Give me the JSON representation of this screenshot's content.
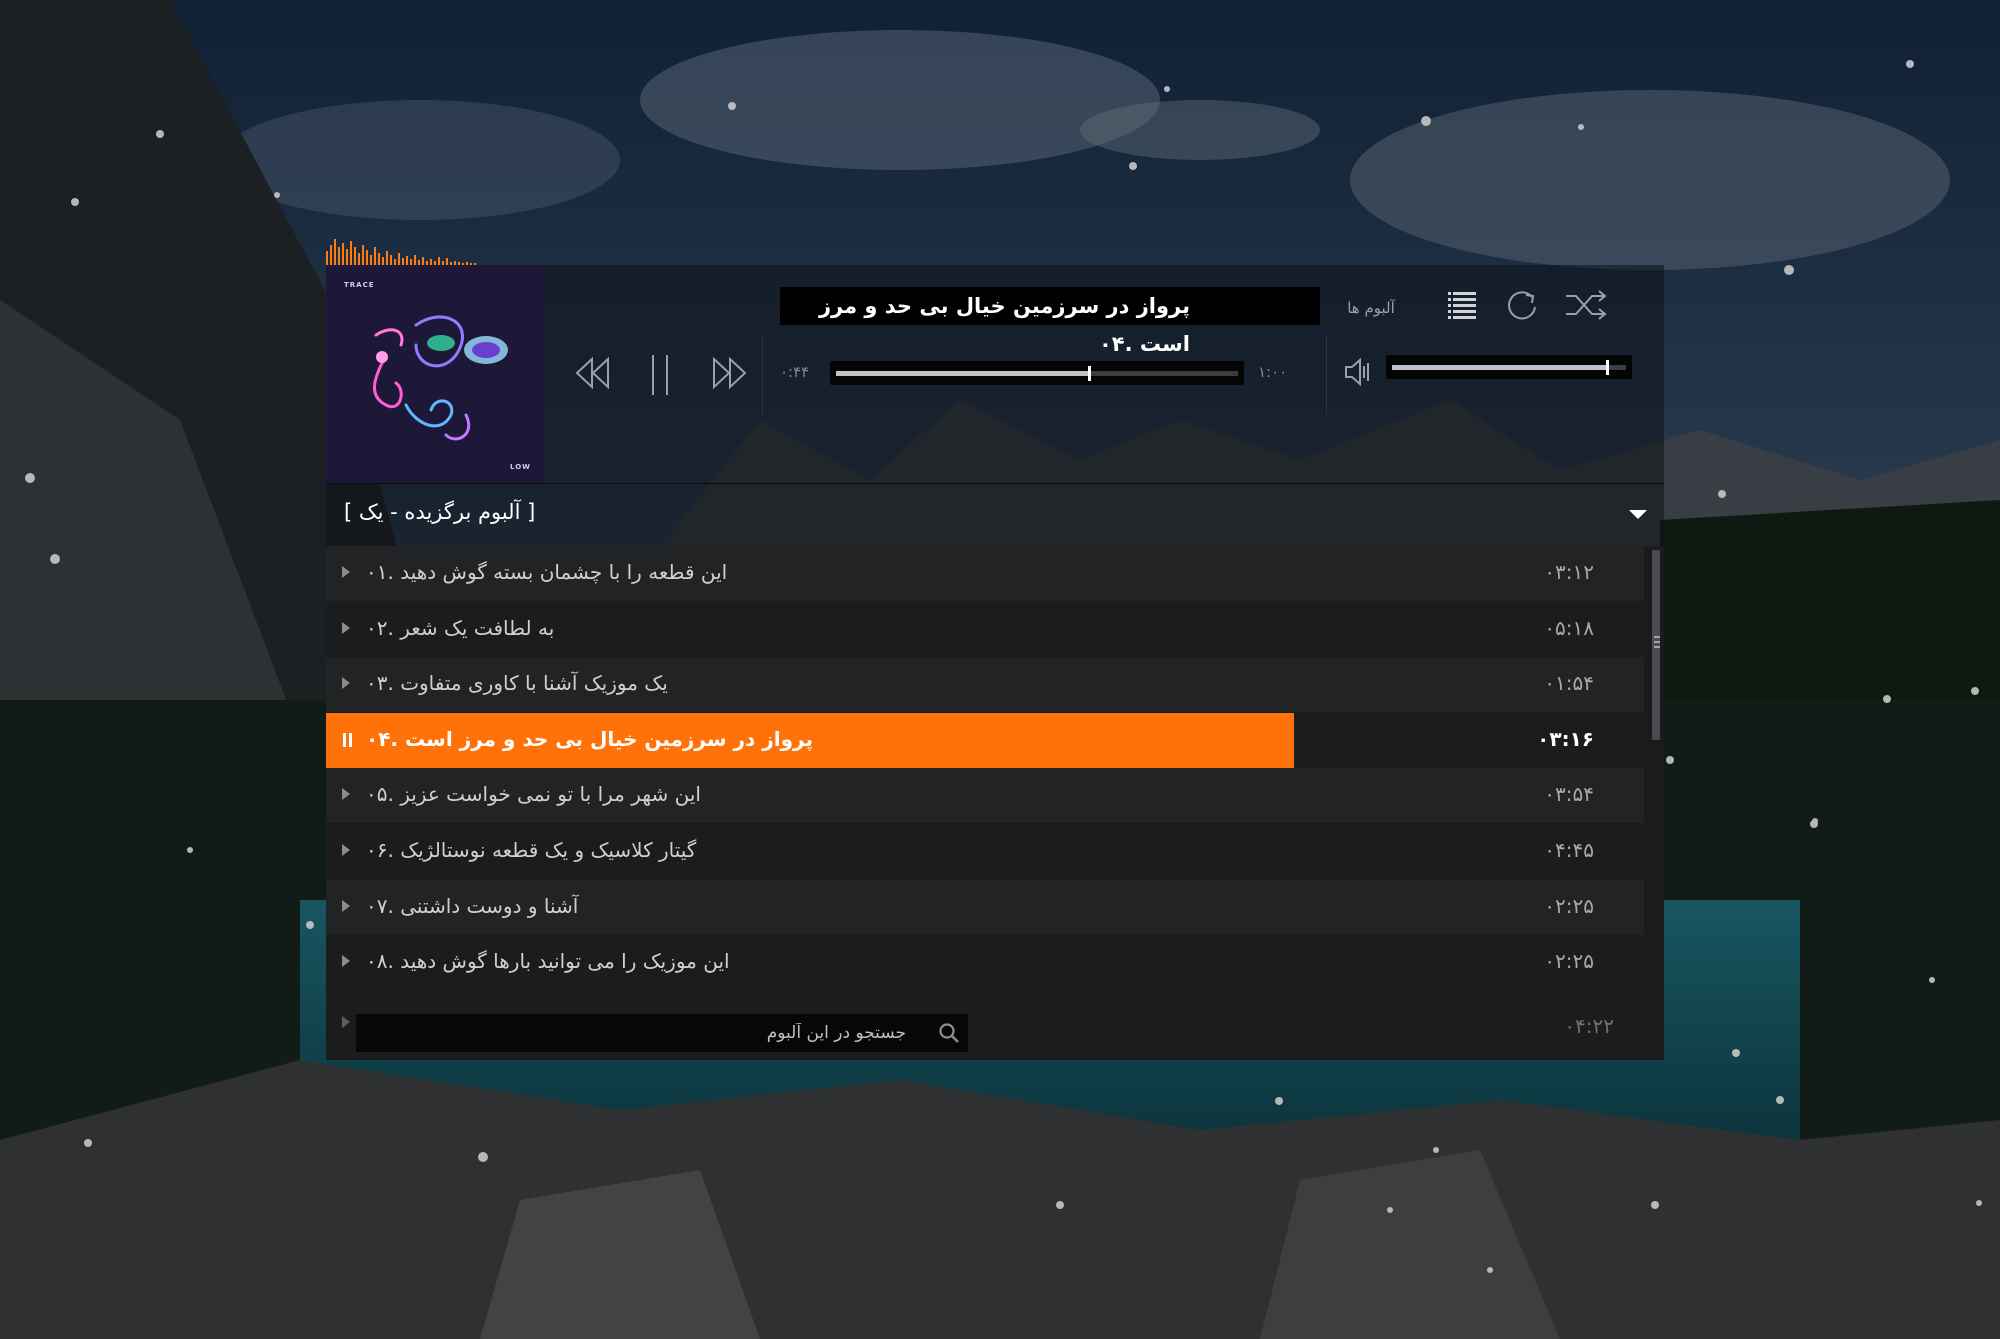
{
  "now_playing": {
    "title": "پرواز در سرزمین خیال بی حد و مرز است .۰۴"
  },
  "toolbar": {
    "albums_label": "آلبوم ها",
    "icons": [
      "playlist-icon",
      "repeat-icon",
      "shuffle-icon",
      "volume-icon",
      "rewind-icon",
      "pause-icon",
      "forward-icon"
    ]
  },
  "progress": {
    "elapsed": "۰:۴۴",
    "total": "۱:۰۰",
    "fraction": 0.63
  },
  "volume": {
    "fraction": 0.92
  },
  "album": {
    "title": "[ آلبوم برگزیده - یک ]",
    "art": {
      "top_text": "TRACE",
      "bottom_text": "LOW"
    }
  },
  "tracks": [
    {
      "title": "این قطعه را با چشمان بسته گوش دهید .۰۱",
      "duration": "۰۳:۱۲",
      "active": false
    },
    {
      "title": "به لطافت یک شعر .۰۲",
      "duration": "۰۵:۱۸",
      "active": false
    },
    {
      "title": "یک موزیک آشنا با کاوری متفاوت .۰۳",
      "duration": "۰۱:۵۴",
      "active": false
    },
    {
      "title": "پرواز در سرزمین خیال بی حد و مرز است .۰۴",
      "duration": "۰۳:۱۶",
      "active": true
    },
    {
      "title": "این شهر مرا با تو نمی خواست عزیز .۰۵",
      "duration": "۰۳:۵۴",
      "active": false
    },
    {
      "title": "گیتار کلاسیک و یک قطعه نوستالژیک .۰۶",
      "duration": "۰۴:۴۵",
      "active": false
    },
    {
      "title": "آشنا و دوست داشتنی .۰۷",
      "duration": "۰۲:۲۵",
      "active": false
    },
    {
      "title": "این موزیک را می توانید بارها گوش دهید .۰۸",
      "duration": "۰۲:۲۵",
      "active": false
    }
  ],
  "last_row_duration": "۰۴:۲۲",
  "search": {
    "placeholder": "جستجو در این آلبوم"
  },
  "colors": {
    "accent": "#ff7209",
    "panel": "#1a1b1d",
    "row_alt": "#222325"
  }
}
